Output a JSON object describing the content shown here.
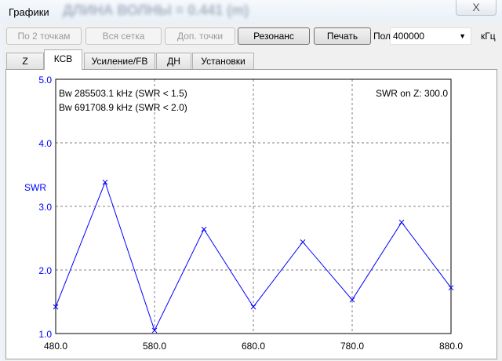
{
  "window": {
    "title": "Графики",
    "background_text": "ДЛИНА ВОЛНЫ = 0.441 (m)",
    "close_label": "X"
  },
  "toolbar": {
    "btn_two_points": "По 2 точкам",
    "btn_all_grid": "Вся сетка",
    "btn_extra_points": "Доп. точки",
    "btn_resonance": "Резонанс",
    "btn_print": "Печать",
    "band_label": "Полоса",
    "band_value": "400000",
    "band_unit": "кГц"
  },
  "tabs": [
    {
      "label": "Z"
    },
    {
      "label": "КСВ",
      "active": true
    },
    {
      "label": "Усиление/FB"
    },
    {
      "label": "ДН"
    },
    {
      "label": "Установки"
    }
  ],
  "colors": {
    "series": "#0000ff",
    "axis_y_labels": "#0000ff",
    "grid": "#808080"
  },
  "chart_data": {
    "type": "line",
    "ylabel": "SWR",
    "annotations": [
      "Bw 285503.1 kHz (SWR < 1.5)",
      "Bw 691708.9 kHz (SWR < 2.0)",
      "SWR on Z: 300.0"
    ],
    "xlim": [
      480,
      880
    ],
    "ylim": [
      1,
      5
    ],
    "x_ticks": [
      "480.0",
      "580.0",
      "680.0",
      "780.0",
      "880.0"
    ],
    "y_ticks": [
      "1.0",
      "2.0",
      "3.0",
      "4.0",
      "5.0"
    ],
    "x_tick_values": [
      480,
      580,
      680,
      780,
      880
    ],
    "y_tick_values": [
      1,
      2,
      3,
      4,
      5
    ],
    "grid": true,
    "series": [
      {
        "name": "SWR",
        "x": [
          480,
          530,
          580,
          630,
          680,
          730,
          780,
          830,
          880
        ],
        "values": [
          1.42,
          3.38,
          1.05,
          2.64,
          1.42,
          2.44,
          1.53,
          2.75,
          1.72
        ]
      }
    ]
  }
}
